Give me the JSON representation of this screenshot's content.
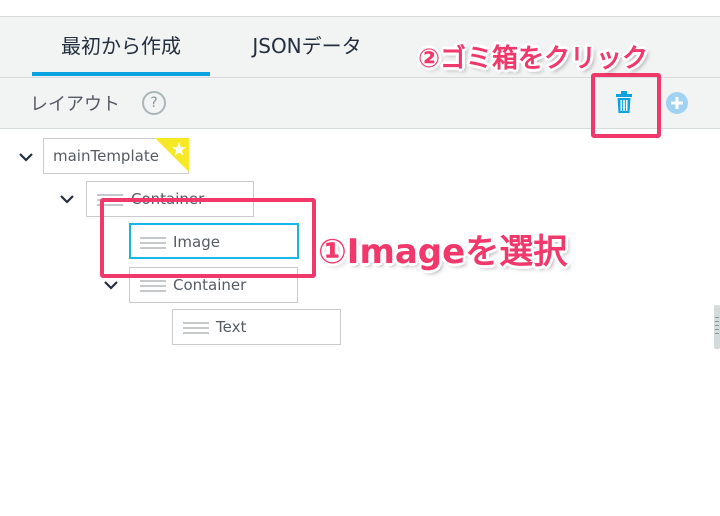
{
  "tabs": [
    {
      "label": "最初から作成",
      "active": true
    },
    {
      "label": "JSONデータ",
      "active": false
    }
  ],
  "toolbar": {
    "title": "レイアウト",
    "help": "?"
  },
  "tree": {
    "root": {
      "label": "mainTemplate"
    },
    "container1": {
      "label": "Container"
    },
    "image": {
      "label": "Image"
    },
    "container2": {
      "label": "Container"
    },
    "text": {
      "label": "Text"
    }
  },
  "annotations": {
    "step1": "①Imageを選択",
    "step2": "②ゴミ箱をクリック"
  },
  "colors": {
    "accent": "#0aa3e0",
    "selected_border": "#1ab5e8",
    "annotation": "#f0386b",
    "star": "#f7e826"
  },
  "icons": [
    "help-icon",
    "trash-icon",
    "plus-circle-icon",
    "chevron-down-icon",
    "drag-handle-icon",
    "star-icon"
  ]
}
